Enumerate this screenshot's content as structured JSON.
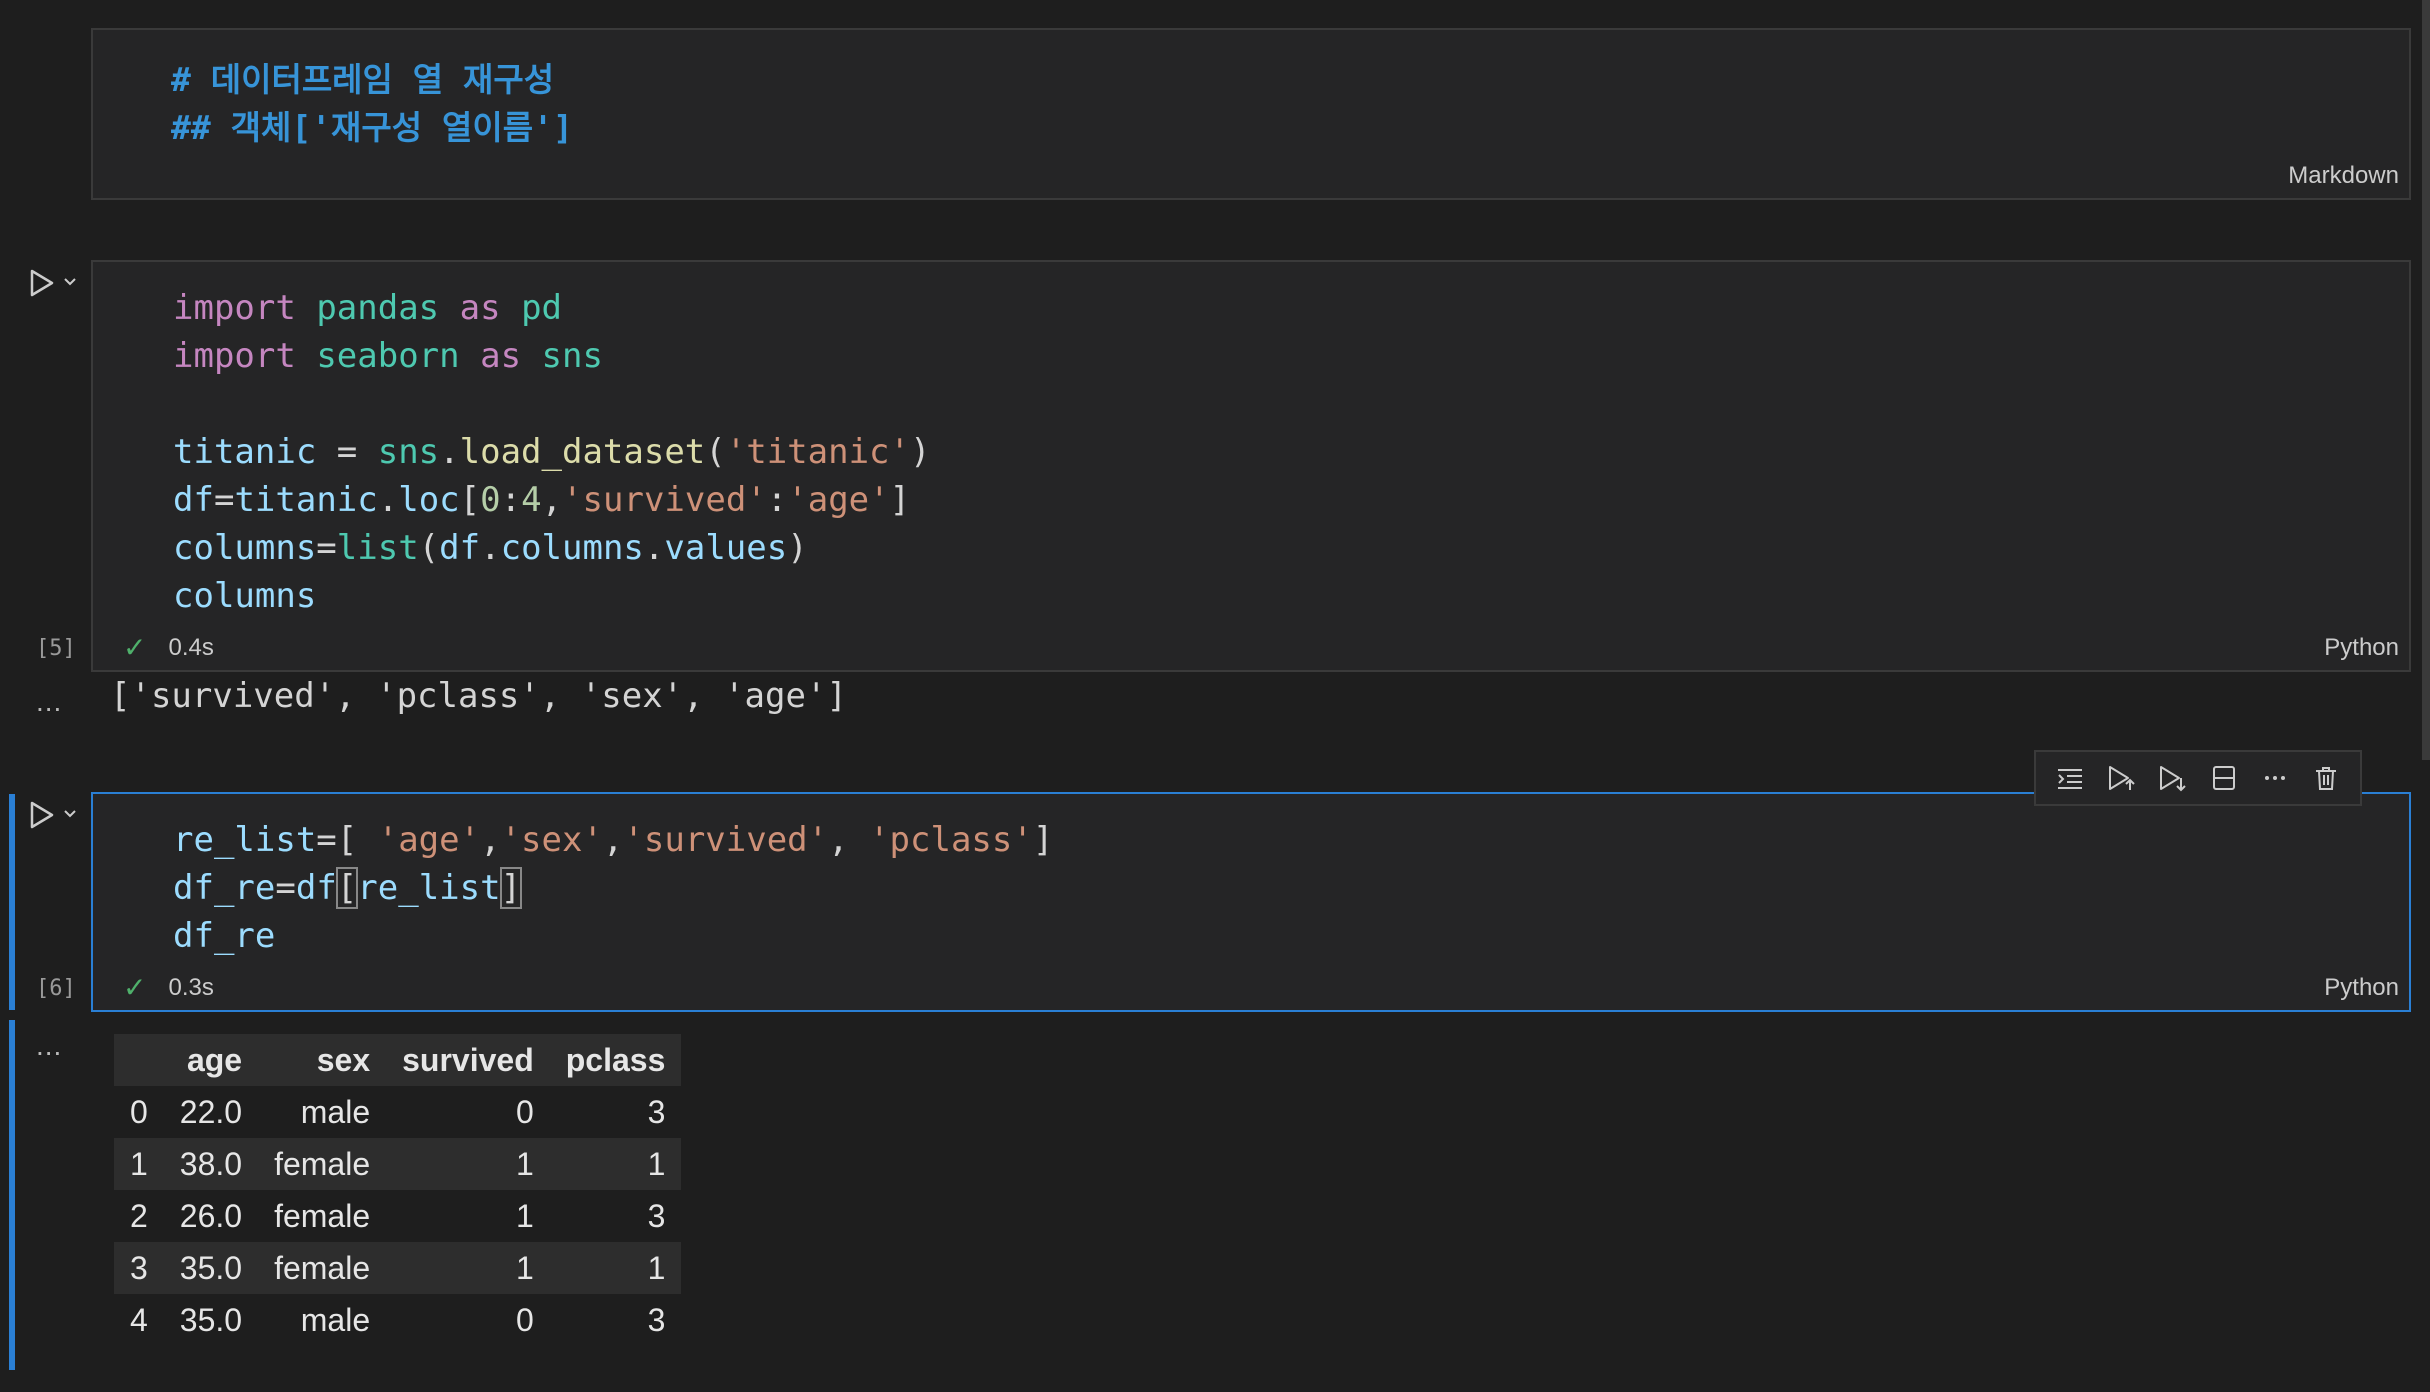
{
  "markdown_cell": {
    "lines": [
      "# 데이터프레임 열 재구성",
      "## 객체['재구성 열이름']"
    ],
    "lang": "Markdown"
  },
  "cell5": {
    "exec_count": "[5]",
    "time": "0.4s",
    "lang": "Python",
    "output": "['survived', 'pclass', 'sex', 'age']",
    "code": {
      "l1": {
        "a": "import",
        "b": "pandas",
        "c": "as",
        "d": "pd"
      },
      "l2": {
        "a": "import",
        "b": "seaborn",
        "c": "as",
        "d": "sns"
      },
      "l4": {
        "a": "titanic",
        "b": " = ",
        "c": "sns",
        "d": ".",
        "e": "load_dataset",
        "f": "(",
        "g": "'titanic'",
        "h": ")"
      },
      "l5": {
        "a": "df",
        "b": "=",
        "c": "titanic",
        "d": ".",
        "e": "loc",
        "f": "[",
        "g": "0",
        "h": ":",
        "i": "4",
        "j": ",",
        "k": "'survived'",
        "l": ":",
        "m": "'age'",
        "n": "]"
      },
      "l6": {
        "a": "columns",
        "b": "=",
        "c": "list",
        "d": "(",
        "e": "df",
        "f": ".",
        "g": "columns",
        "h": ".",
        "i": "values",
        "j": ")"
      },
      "l7": {
        "a": "columns"
      }
    }
  },
  "cell6": {
    "exec_count": "[6]",
    "time": "0.3s",
    "lang": "Python",
    "code": {
      "l1": {
        "a": "re_list",
        "b": "=[ ",
        "c": "'age'",
        "d": ",",
        "e": "'sex'",
        "f": ",",
        "g": "'survived'",
        "h": ", ",
        "i": "'pclass'",
        "j": "]"
      },
      "l2": {
        "a": "df_re",
        "b": "=",
        "c": "df",
        "d": "[",
        "e": "re_list",
        "f": "]"
      },
      "l3": {
        "a": "df_re"
      }
    },
    "table": {
      "columns": [
        "",
        "age",
        "sex",
        "survived",
        "pclass"
      ],
      "rows": [
        [
          "0",
          "22.0",
          "male",
          "0",
          "3"
        ],
        [
          "1",
          "38.0",
          "female",
          "1",
          "1"
        ],
        [
          "2",
          "26.0",
          "female",
          "1",
          "3"
        ],
        [
          "3",
          "35.0",
          "female",
          "1",
          "1"
        ],
        [
          "4",
          "35.0",
          "male",
          "0",
          "3"
        ]
      ]
    }
  },
  "ellipsis": "...",
  "toolbar_icons": [
    "run-by-line-icon",
    "execute-above-icon",
    "execute-below-icon",
    "split-cell-icon",
    "more-icon",
    "delete-icon"
  ],
  "colors": {
    "background": "#1e1e1e",
    "cell_bg": "#252526",
    "accent": "#2a7fd4",
    "markdown_text": "#3794d8",
    "success": "#4fb06b"
  }
}
